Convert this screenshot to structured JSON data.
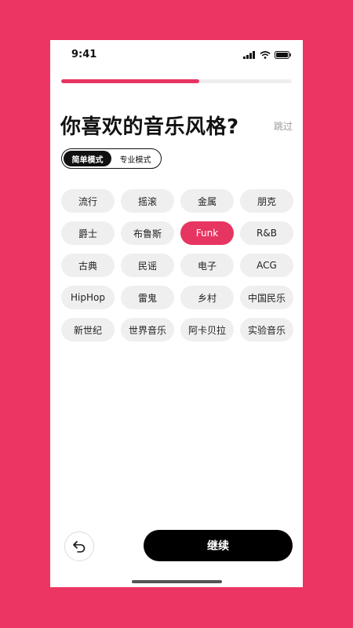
{
  "status_bar": {
    "time": "9:41",
    "icons": [
      "signal-icon",
      "wifi-icon",
      "battery-icon"
    ]
  },
  "progress": {
    "percent": 60
  },
  "header": {
    "title": "你喜欢的音乐风格?",
    "skip_label": "跳过"
  },
  "mode_toggle": {
    "options": [
      "简单模式",
      "专业模式"
    ],
    "selected": "简单模式"
  },
  "genres": [
    "流行",
    "摇滚",
    "金属",
    "朋克",
    "爵士",
    "布鲁斯",
    "Funk",
    "R&B",
    "古典",
    "民谣",
    "电子",
    "ACG",
    "HipHop",
    "雷鬼",
    "乡村",
    "中国民乐",
    "新世纪",
    "世界音乐",
    "阿卡贝拉",
    "实验音乐"
  ],
  "selected_genre": "Funk",
  "footer": {
    "back_icon": "undo-arrow-icon",
    "continue_label": "继续"
  },
  "colors": {
    "accent": "#E73562",
    "background": "#EC3563",
    "button": "#000000",
    "tag_bg": "#EFEFEF"
  }
}
